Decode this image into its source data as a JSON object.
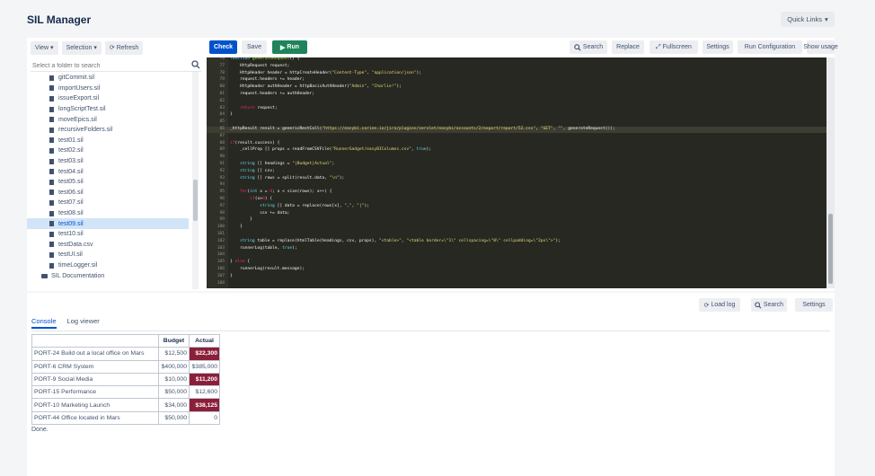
{
  "app": {
    "title": "SIL Manager",
    "quick_links": "Quick Links"
  },
  "left_toolbar": {
    "view": "View",
    "selection": "Selection",
    "refresh": "Refresh"
  },
  "tree_search": {
    "placeholder": "Select a folder to search"
  },
  "tree": {
    "items": [
      {
        "label": "gitCommit.sil",
        "type": "file"
      },
      {
        "label": "importUsers.sil",
        "type": "file"
      },
      {
        "label": "issueExport.sil",
        "type": "file"
      },
      {
        "label": "longScriptTest.sil",
        "type": "file"
      },
      {
        "label": "moveEpics.sil",
        "type": "file"
      },
      {
        "label": "recursiveFolders.sil",
        "type": "file"
      },
      {
        "label": "test01.sil",
        "type": "file"
      },
      {
        "label": "test02.sil",
        "type": "file"
      },
      {
        "label": "test03.sil",
        "type": "file"
      },
      {
        "label": "test04.sil",
        "type": "file"
      },
      {
        "label": "test05.sil",
        "type": "file"
      },
      {
        "label": "test06.sil",
        "type": "file"
      },
      {
        "label": "test07.sil",
        "type": "file"
      },
      {
        "label": "test08.sil",
        "type": "file"
      },
      {
        "label": "test09.sil",
        "type": "file",
        "selected": true
      },
      {
        "label": "test10.sil",
        "type": "file"
      },
      {
        "label": "testData.csv",
        "type": "file"
      },
      {
        "label": "testUI.sil",
        "type": "file"
      },
      {
        "label": "timeLogger.sil",
        "type": "file"
      },
      {
        "label": "SIL Documentation",
        "type": "folder"
      }
    ]
  },
  "editor_toolbar": {
    "check": "Check",
    "save": "Save",
    "run": "Run",
    "search": "Search",
    "replace": "Replace",
    "fullscreen": "Fullscreen",
    "settings": "Settings",
    "run_config": "Run Configuration",
    "show_usage": "Show usage"
  },
  "code": {
    "lines": [
      {
        "n": "76",
        "html": "<span class=\"ty\">function</span> <span class=\"fn\">generateRequest</span>() {"
      },
      {
        "n": "77",
        "html": "    HttpRequest request;"
      },
      {
        "n": "78",
        "html": "    HttpHeader header = httpCreateHeader(<span class=\"st\">\"Content-Type\"</span>, <span class=\"st\">\"application/json\"</span>);"
      },
      {
        "n": "79",
        "html": "    request.headers += header;"
      },
      {
        "n": "80",
        "html": "    HttpHeader authHeader = httpBasicAuthHeader(<span class=\"st\">\"Admin\"</span>, <span class=\"st\">\"Charlie!\"</span>);"
      },
      {
        "n": "81",
        "html": "    request.headers += authHeader;"
      },
      {
        "n": "82",
        "html": ""
      },
      {
        "n": "83",
        "html": "    <span class=\"kw\">return</span> request;"
      },
      {
        "n": "84",
        "html": "}"
      },
      {
        "n": "85",
        "html": ""
      },
      {
        "n": "86",
        "html": "_httpResult result = genericRestCall(<span class=\"st\">\"https://easybi.carine.io/jira/plugins/servlet/easybi/accounts/2/export/report/52.csv\"</span>, <span class=\"st\">\"GET\"</span>, <span class=\"st\">\"\"</span>, generateRequest());",
        "hl": true
      },
      {
        "n": "87",
        "html": ""
      },
      {
        "n": "88",
        "html": "<span class=\"kw\">if</span>(result.success) {"
      },
      {
        "n": "89",
        "html": "    _cellProp [] props = readFromCSVFile(<span class=\"st\">\"RunnerGadget/easyBIColumns.csv\"</span>, <span class=\"ty\">true</span>);"
      },
      {
        "n": "90",
        "html": ""
      },
      {
        "n": "91",
        "html": "    <span class=\"ty\">string</span> [] headings = <span class=\"st\">\"|Budget|Actual\"</span>;"
      },
      {
        "n": "92",
        "html": "    <span class=\"ty\">string</span> [] csv;"
      },
      {
        "n": "93",
        "html": "    <span class=\"ty\">string</span> [] rows = split(result.data, <span class=\"st\">\"\\n\"</span>);"
      },
      {
        "n": "94",
        "html": ""
      },
      {
        "n": "95",
        "html": "    <span class=\"kw\">for</span>(<span class=\"ty\">int</span> x = <span class=\"kw\">0</span>; x < size(rows); x++) {"
      },
      {
        "n": "96",
        "html": "        <span class=\"kw\">if</span>(x><span class=\"kw\">0</span>) {"
      },
      {
        "n": "97",
        "html": "            <span class=\"ty\">string</span> [] data = replace(rows[x], <span class=\"st\">\",\"</span>, <span class=\"st\">\"|\"</span>);"
      },
      {
        "n": "98",
        "html": "            csv += data;"
      },
      {
        "n": "99",
        "html": "        }"
      },
      {
        "n": "100",
        "html": "    }"
      },
      {
        "n": "101",
        "html": ""
      },
      {
        "n": "102",
        "html": "    <span class=\"ty\">string</span> table = replace(htmlTable(headings, csv, props), <span class=\"st\">\"&lt;table&gt;\"</span>, <span class=\"st\">\"&lt;table border=\\\"1\\\" cellspacing=\\\"0\\\" cellpadding=\\\"2px\\\"&gt;\"</span>);"
      },
      {
        "n": "103",
        "html": "    runnerLog(table, <span class=\"ty\">true</span>);"
      },
      {
        "n": "104",
        "html": ""
      },
      {
        "n": "105",
        "html": "} <span class=\"kw\">else</span> {"
      },
      {
        "n": "106",
        "html": "    runnerLog(result.message);"
      },
      {
        "n": "107",
        "html": "}"
      },
      {
        "n": "108",
        "html": ""
      }
    ]
  },
  "bottom_toolbar": {
    "load_log": "Load log",
    "search": "Search",
    "settings": "Settings"
  },
  "tabs": {
    "console": "Console",
    "log_viewer": "Log viewer"
  },
  "output_table": {
    "headers": [
      "",
      "Budget",
      "Actual"
    ],
    "rows": [
      {
        "name": "PORT-24 Build out a local office on Mars",
        "budget": "$12,500",
        "actual": "$22,300",
        "over": true
      },
      {
        "name": "PORT-6 CRM System",
        "budget": "$400,000",
        "actual": "$385,000",
        "over": false
      },
      {
        "name": "PORT-9 Social Media",
        "budget": "$10,000",
        "actual": "$11,200",
        "over": true
      },
      {
        "name": "PORT-15 Performance",
        "budget": "$50,000",
        "actual": "$12,600",
        "over": false
      },
      {
        "name": "PORT-10 Marketing Launch",
        "budget": "$34,000",
        "actual": "$38,125",
        "over": true
      },
      {
        "name": "PORT-44 Office located in Mars",
        "budget": "$50,000",
        "actual": "0",
        "over": false
      }
    ]
  },
  "console_status": "Done.",
  "colors": {
    "primary": "#0052cc",
    "run": "#1f845a",
    "over_budget": "#8b1f3a",
    "editor_bg": "#272822"
  }
}
